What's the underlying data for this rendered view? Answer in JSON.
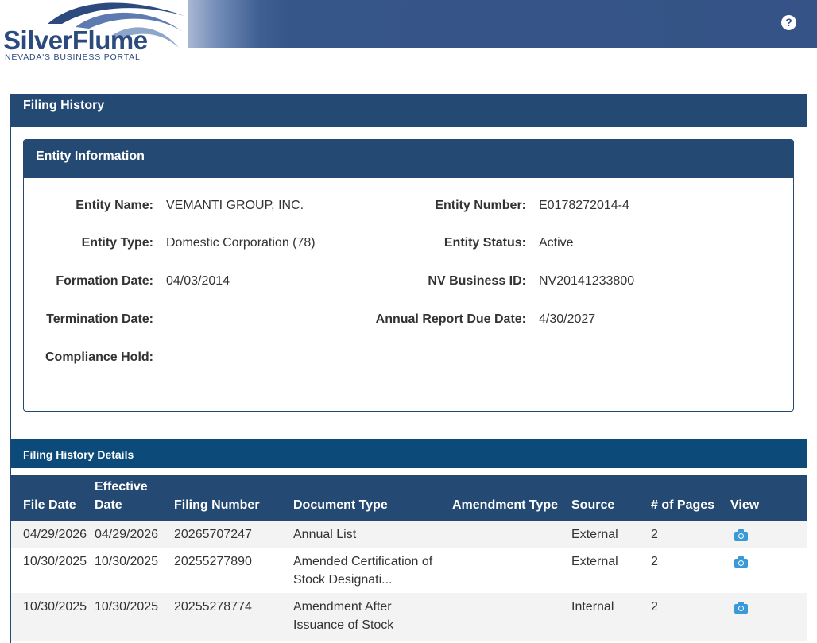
{
  "header": {
    "logo_main": "SilverFlume",
    "logo_sub": "NEVADA'S BUSINESS PORTAL",
    "help_glyph": "?"
  },
  "panel": {
    "title": "Filing History"
  },
  "entity": {
    "title": "Entity Information",
    "left_fields": [
      {
        "label": "Entity Name:",
        "value": "VEMANTI GROUP, INC."
      },
      {
        "label": "Entity Type:",
        "value": "Domestic Corporation (78)"
      },
      {
        "label": "Formation Date:",
        "value": "04/03/2014"
      },
      {
        "label": "Termination Date:",
        "value": ""
      },
      {
        "label": "Compliance Hold:",
        "value": ""
      }
    ],
    "right_fields": [
      {
        "label": "Entity Number:",
        "value": "E0178272014-4"
      },
      {
        "label": "Entity Status:",
        "value": "Active"
      },
      {
        "label": "NV Business ID:",
        "value": "NV20141233800"
      },
      {
        "label": "Annual Report Due Date:",
        "value": "4/30/2027"
      }
    ]
  },
  "details": {
    "title": "Filing History Details",
    "columns": [
      "File Date",
      "Effective Date",
      "Filing Number",
      "Document Type",
      "Amendment Type",
      "Source",
      "# of Pages",
      "View"
    ],
    "rows": [
      {
        "file_date": "04/29/2026",
        "effective_date": "04/29/2026",
        "filing_number": "20265707247",
        "document_type_1": "Annual List",
        "document_type_2": "",
        "amendment_type": "",
        "source": "External",
        "pages": "2",
        "view_icon": "camera-icon"
      },
      {
        "file_date": "10/30/2025",
        "effective_date": "10/30/2025",
        "filing_number": "20255277890",
        "document_type_1": "Amended Certification of",
        "document_type_2": "Stock Designati...",
        "amendment_type": "",
        "source": "External",
        "pages": "2",
        "view_icon": "camera-icon"
      },
      {
        "file_date": "10/30/2025",
        "effective_date": "10/30/2025",
        "filing_number": "20255278774",
        "document_type_1": "Amendment After",
        "document_type_2": "Issuance of Stock",
        "amendment_type": "",
        "source": "Internal",
        "pages": "2",
        "view_icon": "camera-icon"
      }
    ]
  },
  "colors": {
    "header_blue": "#355386",
    "panel_blue": "#244a73",
    "details_blue": "#0c4a7a",
    "icon_blue": "#3a9ad9"
  }
}
